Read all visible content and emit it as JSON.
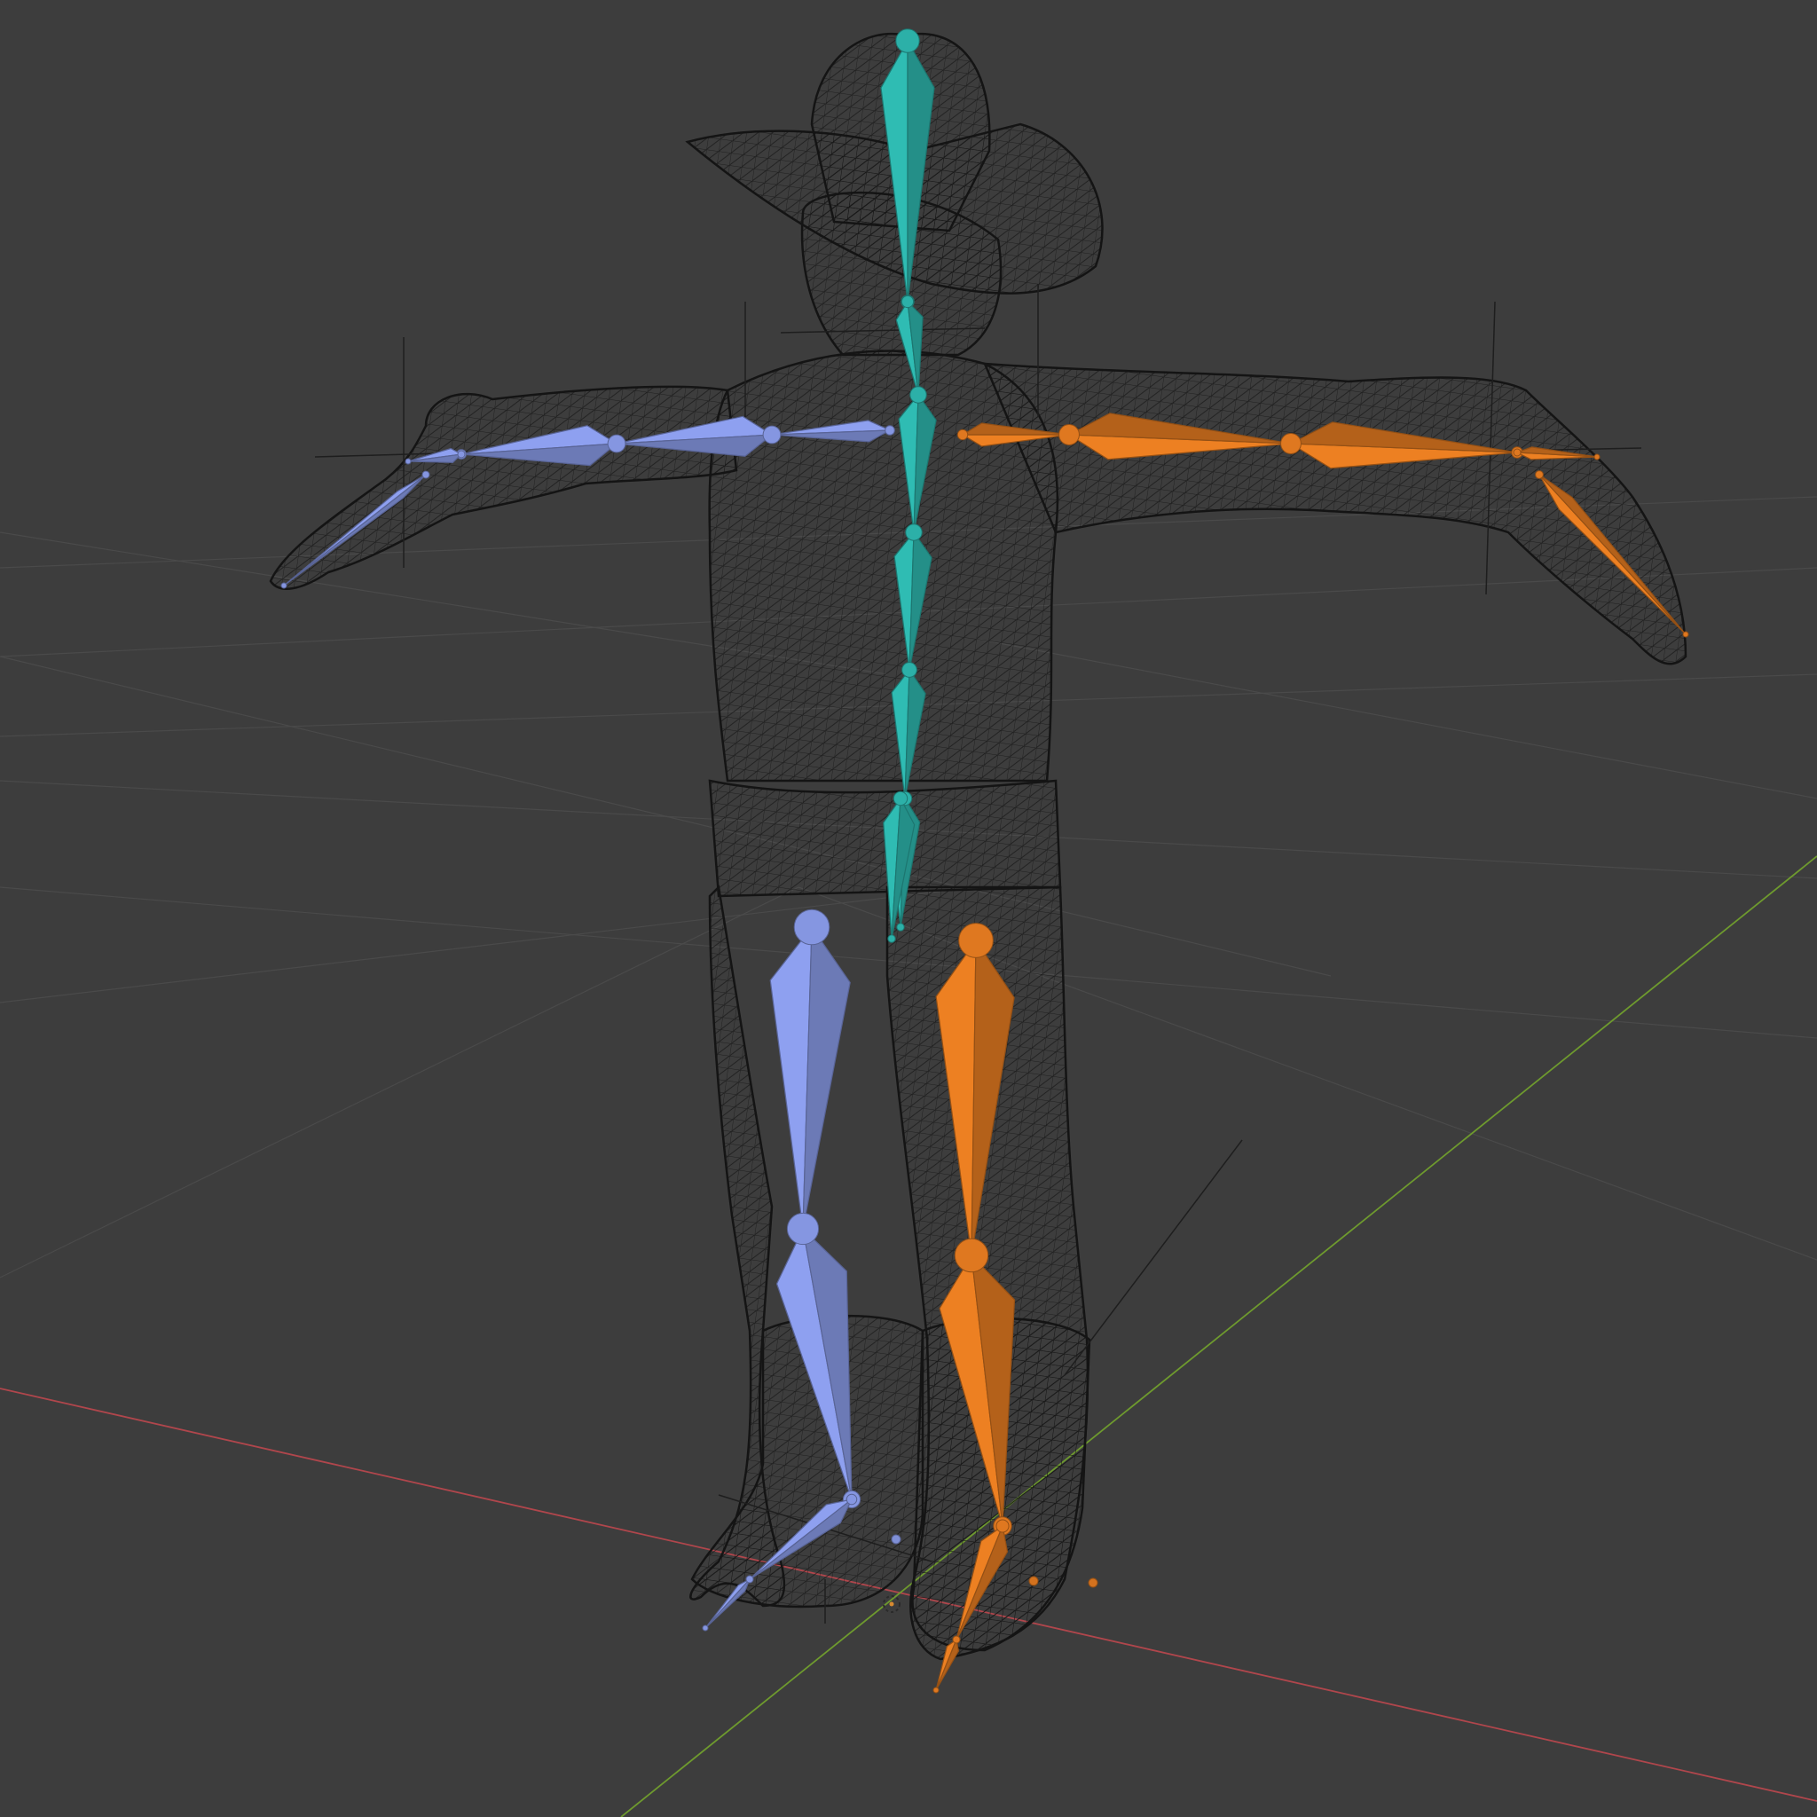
{
  "viewport": {
    "background": "#3d3d3d",
    "grid_color": "#4a4a4a",
    "x_axis_color": "#b0464c",
    "y_axis_color": "#6e9a2e",
    "wireframe_color": "#141414"
  },
  "armature": {
    "center_color": "#2aa8a0",
    "left_color": "#7f8fd6",
    "right_color": "#d4721e",
    "bones": [
      "head",
      "neck",
      "spine-upper",
      "spine-chest",
      "spine-mid",
      "spine-lower",
      "hips",
      "shoulder-left",
      "upper-arm-left",
      "forearm-left",
      "hand-left",
      "fingers-left",
      "shoulder-right",
      "upper-arm-right",
      "forearm-right",
      "hand-right",
      "fingers-right",
      "thigh-left",
      "shin-left",
      "foot-left",
      "toe-left",
      "thigh-right",
      "shin-right",
      "foot-right",
      "toe-right"
    ]
  },
  "mesh": {
    "name": "cowboy-character"
  },
  "icons": {
    "origin": "3d-cursor-icon"
  }
}
